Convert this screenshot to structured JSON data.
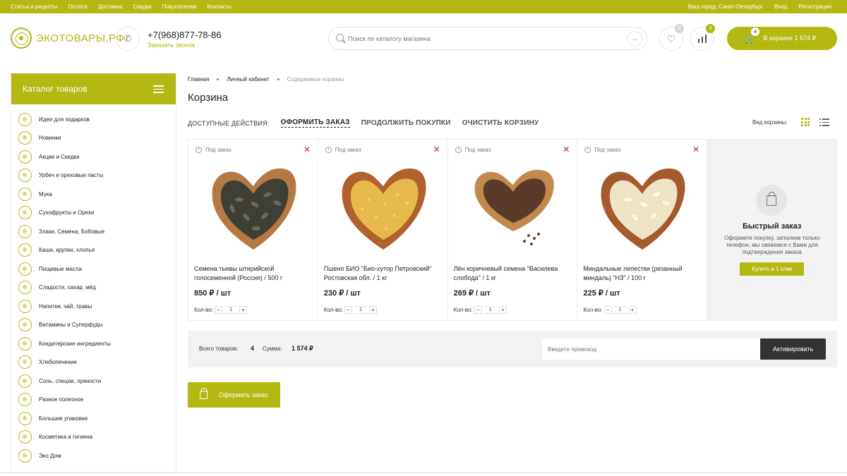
{
  "topbar": {
    "nav": [
      "Статьи и рецепты",
      "Оплата",
      "Доставка",
      "Скидки",
      "Покупателям",
      "Контакты"
    ],
    "city": "Ваш город: Санкт-Петербург",
    "login": "Вход",
    "register": "Регистрация"
  },
  "header": {
    "logo": "ЭКОТОВАРЫ.РФ",
    "phone": "+7(968)877-78-86",
    "callback": "Заказать звонок",
    "search_placeholder": "Поиск по каталогу магазина",
    "favorites_count": "0",
    "compare_count": "3",
    "cart_count": "4",
    "cart_label": "В корзине  1 574 ₽"
  },
  "sidebar": {
    "title": "Каталог товаров",
    "items": [
      "Идеи для подарков",
      "Новинки",
      "Акции и Скидки",
      "Урбеч и ореховые пасты",
      "Мука",
      "Сухофрукты и Орехи",
      "Злаки, Семена, Бобовые",
      "Каши, крупки, хлопья",
      "Пищевые масла",
      "Сладости, сахар, мёд",
      "Напитки, чай, травы",
      "Витамины и Суперфуды",
      "Кондитерские ингредиенты",
      "Хлебопечение",
      "Соль, специи, пряности",
      "Разное полезное",
      "Большие упаковки",
      "Косметика и гигиена",
      "Эко Дом"
    ]
  },
  "breadcrumbs": [
    "Главная",
    "Личный кабинет",
    "Содержимое корзины"
  ],
  "page_title": "Корзина",
  "actions": {
    "label": "ДОСТУПНЫЕ ДЕЙСТВИЯ:",
    "checkout": "ОФОРМИТЬ ЗАКАЗ",
    "continue": "ПРОДОЛЖИТЬ ПОКУПКИ",
    "clear": "ОЧИСТИТЬ КОРЗИНУ",
    "view_label": "Вид корзины:"
  },
  "products": [
    {
      "availability": "Под заказ",
      "name": "Семена тыквы штирийской голосеменной (Россия) / 500 г",
      "price": "850 ₽ / шт",
      "qty_label": "Кол-во:",
      "qty": "1"
    },
    {
      "availability": "Под заказ",
      "name": "Пшено БИО \"Био-хутор Петровский\" Ростовская обл. / 1 кг",
      "price": "230 ₽ / шт",
      "qty_label": "Кол-во:",
      "qty": "1"
    },
    {
      "availability": "Под заказ",
      "name": "Лён коричневый семена \"Василева слобода\" / 1 кг",
      "price": "269 ₽ / шт",
      "qty_label": "Кол-во:",
      "qty": "1"
    },
    {
      "availability": "Под заказ",
      "name": "Миндальные лепестки (резанный миндаль) \"НЗ\" / 100 г",
      "price": "225 ₽ / шт",
      "qty_label": "Кол-во:",
      "qty": "1"
    }
  ],
  "quick_order": {
    "title": "Быстрый заказ",
    "text": "Оформите покупку, заполнив только телефон, мы свяжемся с Вами для подтверждения заказа",
    "button": "Купить в 1 клик"
  },
  "summary": {
    "total_label": "Всего товаров:",
    "total_count": "4",
    "sum_label": "Сумма:",
    "sum_value": "1 574 ₽",
    "promo_placeholder": "Введите промокод",
    "activate": "Активировать"
  },
  "order_button": "Оформить заказ",
  "colors": {
    "accent": "#b4b812",
    "delete": "#d4163c",
    "dark_button": "#333333"
  }
}
